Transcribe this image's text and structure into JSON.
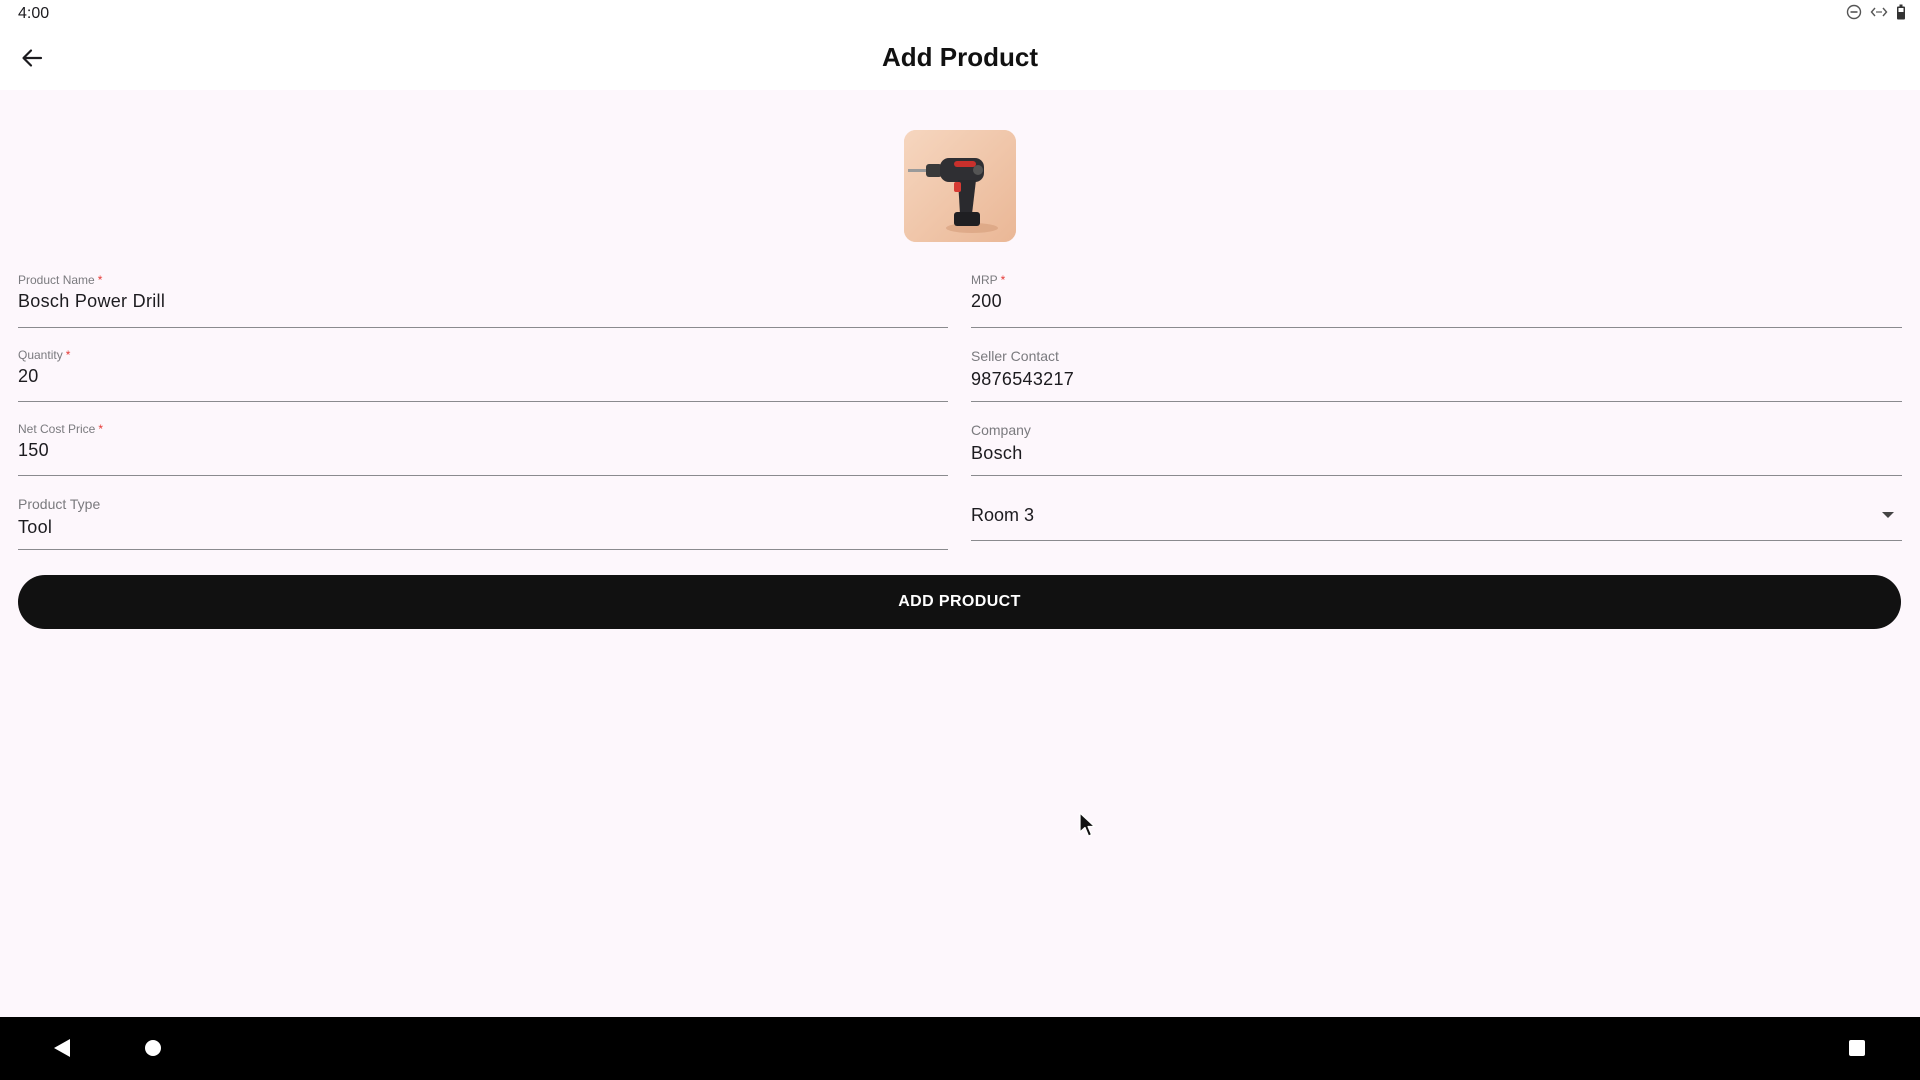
{
  "status_bar": {
    "time": "4:00",
    "icons": [
      "do-not-disturb-icon",
      "data-sync-icon",
      "battery-icon"
    ]
  },
  "app_bar": {
    "title": "Add Product",
    "back_icon": "arrow-left-icon"
  },
  "product_image": {
    "icon": "power-drill-photo",
    "background": "#f2c9ad"
  },
  "form": {
    "product_name": {
      "label": "Product Name",
      "required": "*",
      "value": "Bosch Power Drill"
    },
    "mrp": {
      "label": "MRP",
      "required": "*",
      "value": "200"
    },
    "quantity": {
      "label": "Quantity",
      "required": "*",
      "value": "20"
    },
    "seller_contact": {
      "label": "Seller Contact",
      "value": "9876543217"
    },
    "net_cost_price": {
      "label": "Net Cost Price",
      "required": "*",
      "value": "150"
    },
    "company": {
      "label": "Company",
      "value": "Bosch"
    },
    "product_type": {
      "label": "Product Type",
      "value": "Tool"
    },
    "room": {
      "selected": "Room 3",
      "icon": "dropdown-caret-icon"
    }
  },
  "submit_button": {
    "label": "ADD PRODUCT",
    "color": "#111111"
  },
  "nav_bar": {
    "icons": [
      "nav-back-icon",
      "nav-home-icon",
      "nav-recents-icon"
    ]
  },
  "colors": {
    "background": "#fdf7fc",
    "required": "#e53935"
  }
}
